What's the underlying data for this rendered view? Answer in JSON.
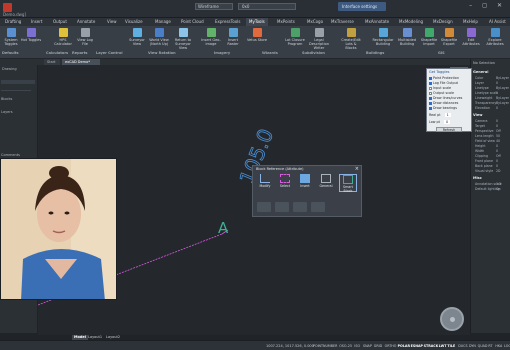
{
  "titlebar": {
    "doc_title": "Demo.dwg]",
    "workspace": "Wireframe",
    "layer": "0x0",
    "interface_settings": "Interface settings",
    "window_controls": "– ◻ ✕"
  },
  "tabs": [
    "Drafting",
    "Insert",
    "Output",
    "Annotate",
    "View",
    "Visualize",
    "Manage",
    "Point Cloud",
    "ExpressTools",
    "MyTools",
    "MxPoints",
    "MxCogo",
    "MxTraverse",
    "MxAnnotate",
    "MxModeling",
    "MxDesign",
    "MxHelp",
    "AI Assist"
  ],
  "active_tab": "MyTools",
  "ribbon": {
    "tools": [
      {
        "label": "System Toggles",
        "color": "#5a8fd1"
      },
      {
        "label": "Hot Toggles",
        "color": "#7b6fd0"
      },
      {
        "label": "HPS Calculator",
        "color": "#e0c13e"
      },
      {
        "label": "View Log File",
        "color": "#9aa0a8"
      },
      {
        "label": "Surveyor View",
        "color": "#5fb0e0"
      },
      {
        "label": "World View (North Up)",
        "color": "#4a7fc8"
      },
      {
        "label": "Return to Surveyor View",
        "color": "#8cc4e8"
      },
      {
        "label": "Insert Geo-image",
        "color": "#62b26a"
      },
      {
        "label": "Insert Raster",
        "color": "#5aa0d0"
      },
      {
        "label": "Vetus Store",
        "color": "#e06a3e"
      },
      {
        "label": "Lot Closure Program",
        "color": "#4ea06a"
      },
      {
        "label": "Legal Description Writer",
        "color": "#9aa0a8"
      },
      {
        "label": "Create/Edit Lots & Blocks",
        "color": "#c0a040"
      },
      {
        "label": "Rectangular Building",
        "color": "#58a6d8"
      },
      {
        "label": "Multisided Building",
        "color": "#6a8fd0"
      },
      {
        "label": "Shapefile Import",
        "color": "#3fa86a"
      },
      {
        "label": "Shapefile Export",
        "color": "#d08a3a"
      },
      {
        "label": "Edit Attributes",
        "color": "#8a6ad0"
      },
      {
        "label": "Explore Attributes",
        "color": "#4a90c8"
      }
    ],
    "groups": [
      "Defaults",
      "Calculators",
      "Reports",
      "Layer Control",
      "View Rotation",
      "Imagery",
      "Wizards",
      "Subdivision",
      "Buildings",
      "GIS"
    ]
  },
  "doc_tabs": [
    "Start",
    "exCAD Demo*"
  ],
  "left_panel": {
    "header": "Drawing",
    "items": [
      "Blocks",
      "Layers",
      "Comments"
    ]
  },
  "canvas": {
    "dimension_text": "105.0",
    "marker_text": "A",
    "viewcube": "TOP"
  },
  "osnap": {
    "title": "Get Toggles",
    "items": [
      {
        "label": "Point Protection",
        "on": true
      },
      {
        "label": "Log File Output",
        "on": true
      },
      {
        "label": "Input scale",
        "on": false
      },
      {
        "label": "Output scale",
        "on": false
      },
      {
        "label": "Draw lines/curves",
        "on": true
      },
      {
        "label": "Draw distances",
        "on": true
      },
      {
        "label": "Draw bearings",
        "on": true
      }
    ],
    "real_pt_label": "Real pt",
    "real_pt_value": "1",
    "low_pt_label": "Low pt",
    "low_pt_value": "0",
    "button": "Refresh"
  },
  "block_palette": {
    "title": "Block Reference (Attribute)",
    "buttons": [
      "Modify",
      "Select",
      "Insert",
      "General",
      "Smart Block"
    ]
  },
  "right_panel": {
    "title": "No Selection",
    "sections": [
      {
        "name": "General",
        "rows": [
          {
            "k": "Color",
            "v": "ByLayer"
          },
          {
            "k": "Layer",
            "v": "0"
          },
          {
            "k": "Linetype",
            "v": "ByLayer"
          },
          {
            "k": "Linetype scale",
            "v": "1"
          },
          {
            "k": "Lineweight",
            "v": "ByLayer"
          },
          {
            "k": "Transparency",
            "v": "ByLayer"
          },
          {
            "k": "Elevation",
            "v": "0"
          }
        ]
      },
      {
        "name": "View",
        "rows": [
          {
            "k": "Camera",
            "v": "0"
          },
          {
            "k": "Target",
            "v": "0"
          },
          {
            "k": "Perspective",
            "v": "Off"
          },
          {
            "k": "Lens length",
            "v": "50"
          },
          {
            "k": "Field of view",
            "v": "40"
          },
          {
            "k": "Height",
            "v": "0"
          },
          {
            "k": "Width",
            "v": "0"
          },
          {
            "k": "Clipping",
            "v": "Off"
          },
          {
            "k": "Front plane",
            "v": "0"
          },
          {
            "k": "Back plane",
            "v": "0"
          },
          {
            "k": "Visual style",
            "v": "2D"
          }
        ]
      },
      {
        "name": "Misc",
        "rows": [
          {
            "k": "Annotation scale",
            "v": "1:1"
          },
          {
            "k": "Default lighting",
            "v": "On"
          }
        ]
      }
    ]
  },
  "layouts": [
    "Model",
    "Layout1",
    "Layout2"
  ],
  "status": {
    "coords": "1007.224, 1017.526, 0.000",
    "items": [
      "POINTNUMBER",
      "OSO-25",
      "ISO",
      "SNAP",
      "GRID",
      "ORTHO",
      "POLAR",
      "ESNAP",
      "STRACK",
      "LWT",
      "TILE",
      "DUCS",
      "DYN",
      "QUAD",
      "RT",
      "HKA",
      "LOCKUI",
      "None"
    ],
    "on_items": [
      "POLAR",
      "ESNAP",
      "STRACK",
      "LWT",
      "TILE"
    ]
  },
  "colors": {
    "accent": "#3e5a80",
    "dimension": "#4a8fd6",
    "line": "#d65ce0",
    "marker": "#3fae94"
  }
}
